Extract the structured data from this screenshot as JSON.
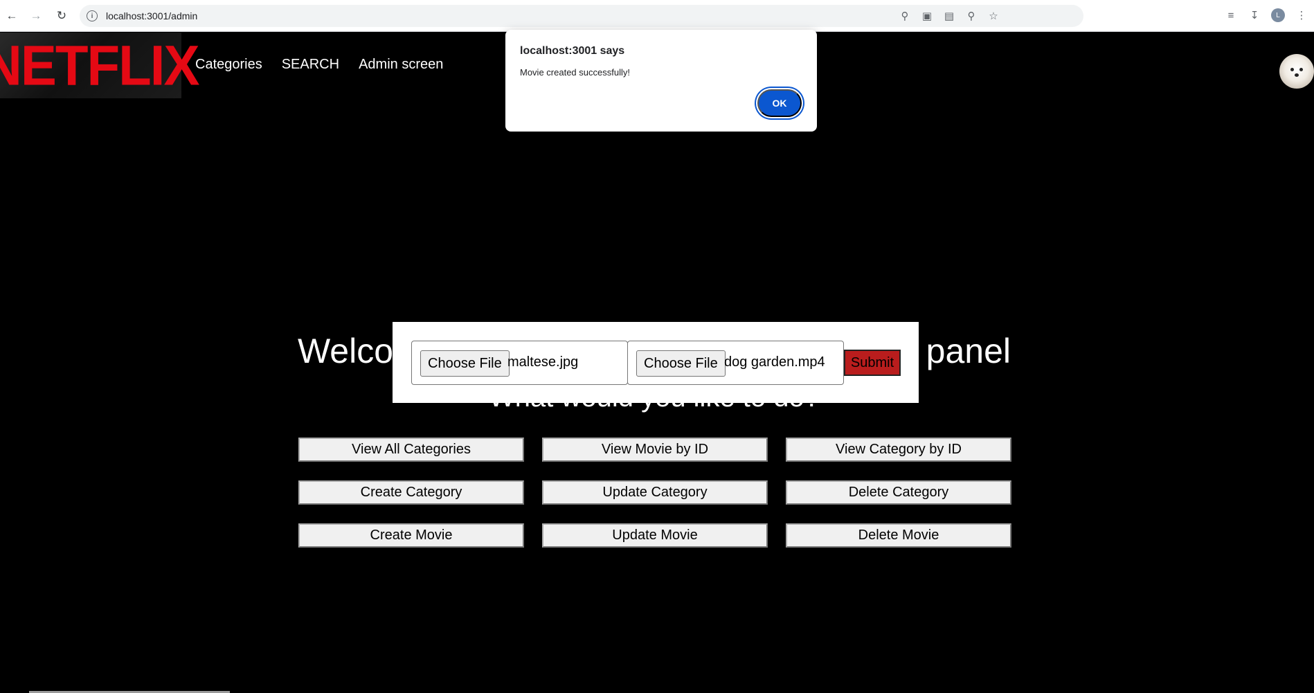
{
  "browser": {
    "url": "localhost:3001/admin",
    "icons": [
      "back-arrow-icon",
      "forward-arrow-icon",
      "reload-icon",
      "info-icon",
      "key-icon",
      "install-icon",
      "translate-icon",
      "zoom-icon",
      "star-icon",
      "tab-search-icon",
      "download-icon",
      "profile-icon",
      "menu-icon"
    ],
    "profile_initial": "L"
  },
  "header": {
    "logo": "NETFLIX",
    "nav": [
      "Categories",
      "SEARCH",
      "Admin screen"
    ]
  },
  "main": {
    "welcome_left": "Welco",
    "welcome_right": "panel",
    "subtitle": "What would you like to do?",
    "actions": [
      "View All Categories",
      "View Movie by ID",
      "View Category by ID",
      "Create Category",
      "Update Category",
      "Delete Category",
      "Create Movie",
      "Update Movie",
      "Delete Movie"
    ]
  },
  "upload": {
    "choose_label": "Choose File",
    "image_file": "maltese.jpg",
    "video_file": "dog garden.mp4",
    "submit_label": "Submit"
  },
  "dialog": {
    "title": "localhost:3001 says",
    "message": "Movie created successfully!",
    "ok_label": "OK"
  },
  "colors": {
    "brand": "#e50914",
    "submit": "#b91d1d",
    "dialog_button": "#0b57d0"
  }
}
